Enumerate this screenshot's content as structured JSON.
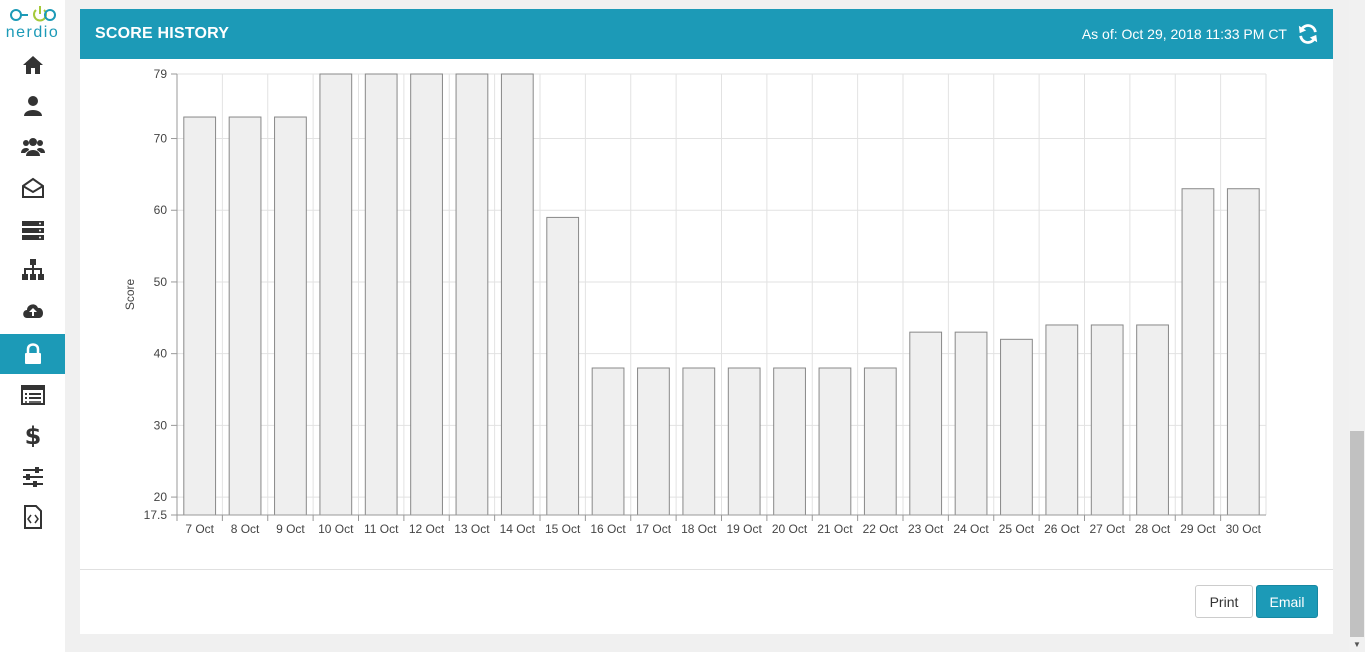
{
  "logo": {
    "brand": "nerdio"
  },
  "nav": [
    {
      "name": "home",
      "icon": "home-icon"
    },
    {
      "name": "user",
      "icon": "user-icon"
    },
    {
      "name": "users",
      "icon": "users-icon"
    },
    {
      "name": "mail",
      "icon": "envelope-open-icon"
    },
    {
      "name": "servers",
      "icon": "server-icon"
    },
    {
      "name": "sitemap",
      "icon": "sitemap-icon"
    },
    {
      "name": "cloud-upload",
      "icon": "cloud-upload-icon"
    },
    {
      "name": "security",
      "icon": "lock-icon",
      "active": true
    },
    {
      "name": "list",
      "icon": "list-icon"
    },
    {
      "name": "billing",
      "icon": "dollar-icon"
    },
    {
      "name": "settings",
      "icon": "sliders-icon"
    },
    {
      "name": "code",
      "icon": "file-code-icon"
    }
  ],
  "header": {
    "title": "SCORE HISTORY",
    "as_of": "As of: Oct 29, 2018 11:33 PM CT",
    "refresh_icon": "refresh-icon"
  },
  "buttons": {
    "print": "Print",
    "email": "Email"
  },
  "colors": {
    "accent": "#1c9ab7",
    "bar_fill": "#efefef",
    "bar_stroke": "#888888"
  },
  "chart_data": {
    "type": "bar",
    "title": "",
    "xlabel": "",
    "ylabel": "Score",
    "ylim": [
      17.5,
      79
    ],
    "yticks": [
      17.5,
      20,
      30,
      40,
      50,
      60,
      70,
      79
    ],
    "grid": true,
    "categories": [
      "7 Oct",
      "8 Oct",
      "9 Oct",
      "10 Oct",
      "11 Oct",
      "12 Oct",
      "13 Oct",
      "14 Oct",
      "15 Oct",
      "16 Oct",
      "17 Oct",
      "18 Oct",
      "19 Oct",
      "20 Oct",
      "21 Oct",
      "22 Oct",
      "23 Oct",
      "24 Oct",
      "25 Oct",
      "26 Oct",
      "27 Oct",
      "28 Oct",
      "29 Oct",
      "30 Oct"
    ],
    "values": [
      73,
      73,
      73,
      79,
      79,
      79,
      79,
      79,
      59,
      38,
      38,
      38,
      38,
      38,
      38,
      38,
      43,
      43,
      42,
      44,
      44,
      44,
      63,
      63
    ]
  }
}
